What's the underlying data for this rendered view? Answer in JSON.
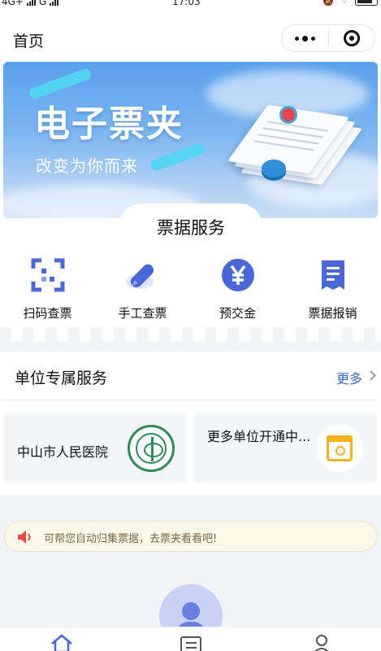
{
  "status_bar": {
    "network": "4G+",
    "carrier": "G",
    "time": "17:03"
  },
  "nav": {
    "title": "首页"
  },
  "banner": {
    "title": "电子票夹",
    "subtitle": "改变为你而来"
  },
  "ticket_section": {
    "title": "票据服务",
    "items": [
      {
        "label": "扫码查票",
        "icon": "scan-icon"
      },
      {
        "label": "手工查票",
        "icon": "pencil-icon"
      },
      {
        "label": "预交金",
        "icon": "yen-icon"
      },
      {
        "label": "票据报销",
        "icon": "receipt-icon"
      }
    ]
  },
  "unit_section": {
    "title": "单位专属服务",
    "more": "更多",
    "units": [
      {
        "name": "中山市人民医院",
        "icon": "hospital-logo-icon"
      },
      {
        "name": "更多单位开通中...",
        "icon": "calendar-icon"
      }
    ]
  },
  "notice": {
    "text": "可帮您自动归集票据，去票夹看看吧!"
  },
  "tabs": [
    {
      "icon": "home-icon"
    },
    {
      "icon": "list-icon"
    },
    {
      "icon": "user-icon"
    }
  ],
  "colors": {
    "primary": "#4a67d8",
    "link": "#3d68c8",
    "notice_bg": "#fdf8ea",
    "calendar": "#f5b01e",
    "speaker": "#e84a3b"
  }
}
